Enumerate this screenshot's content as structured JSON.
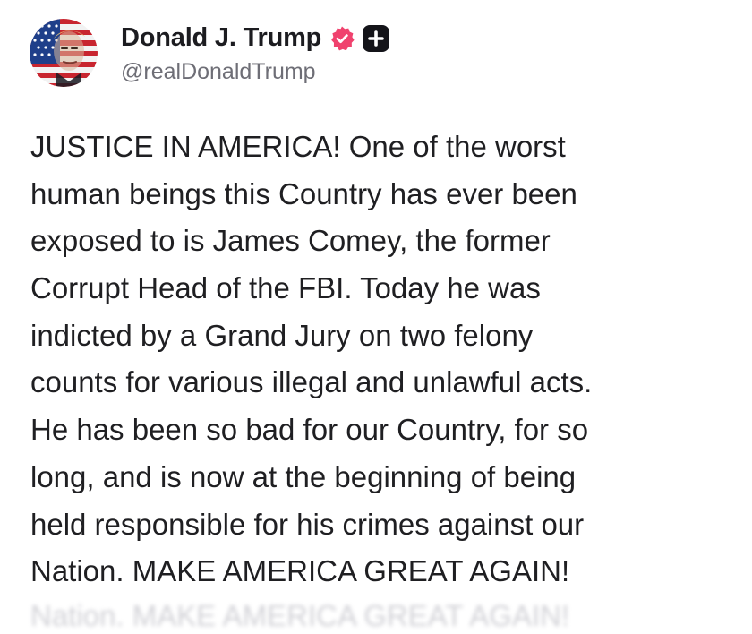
{
  "author": {
    "display_name": "Donald J. Trump",
    "handle": "@realDonaldTrump",
    "avatar_icon": "portrait-flag-avatar-icon",
    "verified_icon": "verified-badge-icon",
    "plus_icon": "plus-badge-icon"
  },
  "post": {
    "lines": [
      "JUSTICE IN AMERICA! One of the worst",
      "human beings this Country has ever been",
      "exposed to is James Comey, the former",
      "Corrupt Head of the FBI. Today he was",
      "indicted by a Grand Jury on two felony",
      "counts for various illegal and unlawful acts.",
      "He has been so bad for our Country, for so",
      "long, and is now at the beginning of being",
      "held responsible for his crimes against our",
      "Nation. MAKE AMERICA GREAT AGAIN!"
    ],
    "ghost_line": "Nation. MAKE AMERICA GREAT AGAIN!"
  },
  "colors": {
    "text": "#1f1f22",
    "handle": "#6e6e76",
    "verified_badge": "#f0426e",
    "plus_badge": "#141419"
  }
}
